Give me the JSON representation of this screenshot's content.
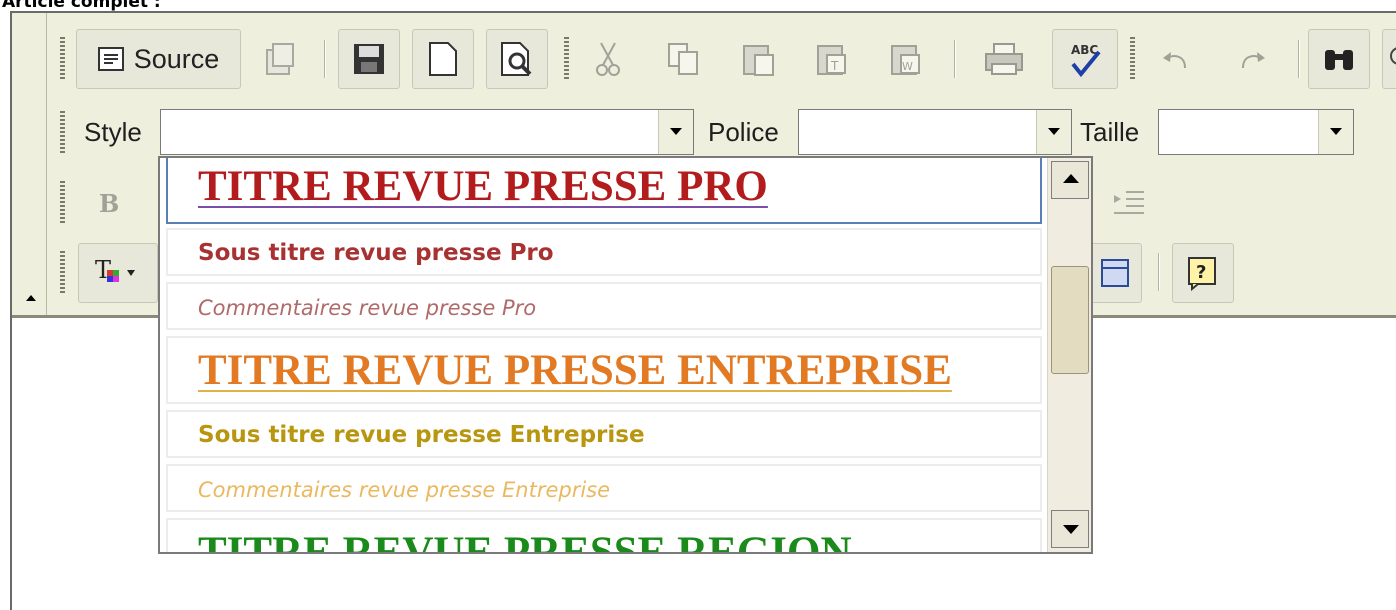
{
  "caption": "Article complet :",
  "toolbar1": {
    "source_label": "Source"
  },
  "toolbar2": {
    "style_label": "Style",
    "style_value": "",
    "font_label": "Police",
    "font_value": "",
    "size_label": "Taille",
    "size_value": ""
  },
  "style_dropdown": {
    "items": [
      {
        "label": "TITRE REVUE PRESSE PRO",
        "kind": "title",
        "color": "#b31c1c",
        "underline": "#7a4fa8"
      },
      {
        "label": "Sous titre revue presse Pro",
        "kind": "subtitle",
        "color": "#a83232"
      },
      {
        "label": "Commentaires revue presse Pro",
        "kind": "comment",
        "color": "#b06a6a"
      },
      {
        "label": "TITRE REVUE PRESSE ENTREPRISE",
        "kind": "title",
        "color": "#e27a24",
        "underline": "#e2b24a"
      },
      {
        "label": "Sous titre revue presse Entreprise",
        "kind": "subtitle",
        "color": "#b8960f"
      },
      {
        "label": "Commentaires revue presse Entreprise",
        "kind": "comment",
        "color": "#eab860"
      },
      {
        "label": "TITRE REVUE PRESSE REGION",
        "kind": "title",
        "color": "#1a8a1a",
        "underline": "#1a8a1a"
      }
    ]
  },
  "colors": {
    "toolbar_bg": "#efefde",
    "active_item_border": "#5a7fb5"
  }
}
